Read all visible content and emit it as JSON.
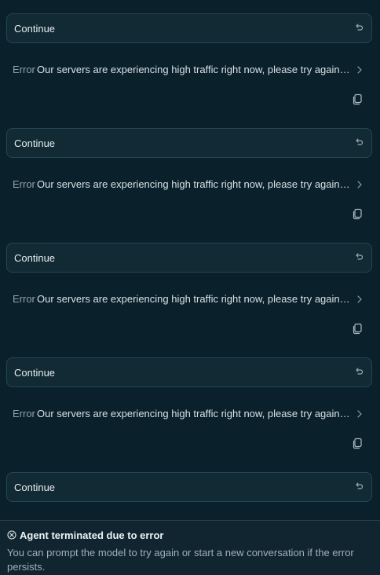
{
  "messages": [
    {
      "continue_label": "Continue",
      "error_tag": "Error",
      "error_text": "Our servers are experiencing high traffic right now, please try again in a minute."
    },
    {
      "continue_label": "Continue",
      "error_tag": "Error",
      "error_text": "Our servers are experiencing high traffic right now, please try again in a minute."
    },
    {
      "continue_label": "Continue",
      "error_tag": "Error",
      "error_text": "Our servers are experiencing high traffic right now, please try again in a minute."
    },
    {
      "continue_label": "Continue",
      "error_tag": "Error",
      "error_text": "Our servers are experiencing high traffic right now, please try again in a minute."
    },
    {
      "continue_label": "Continue"
    }
  ],
  "banner": {
    "title": "Agent terminated due to error",
    "description": "You can prompt the model to try again or start a new conversation if the error persists."
  },
  "colors": {
    "background": "#0a202b",
    "card": "#112a34",
    "border": "#244653",
    "muted": "#8fa3ad"
  },
  "icons": {
    "undo": "undo-icon",
    "chevron": "chevron-right-icon",
    "copy": "copy-icon",
    "error": "circle-x-icon"
  }
}
